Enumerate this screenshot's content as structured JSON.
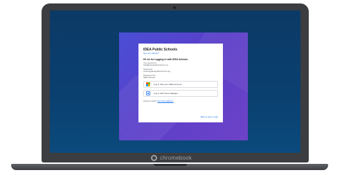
{
  "device": {
    "brand": "chromebook"
  },
  "login": {
    "org_title": "IDEA Public Schools",
    "org_subtitle": "Not your district?",
    "heading": "Hi! As for Logging in with IDEA Schools",
    "email_label": "Your account is",
    "email_value": "Staff@ideapublicschools.org",
    "id_label": "Student ID",
    "id_value": "student@ideapublicschools.org",
    "password_label": "Password hint",
    "password_value": "IDEA Schools",
    "microsoft_button": "Log in with your IDEA Account",
    "badge_button": "Log in with Clever Badges",
    "help_prefix": "Having trouble?",
    "help_link": "Get help logging in",
    "signin_link": "Back to sign in page"
  },
  "colors": {
    "screen_bg": "#0c3a66",
    "backdrop": "#5a3fc9",
    "link": "#1a73e8"
  },
  "icons": {
    "microsoft": "microsoft-icon",
    "badge": "badge-icon",
    "chromebook": "chromebook-logo-icon"
  }
}
